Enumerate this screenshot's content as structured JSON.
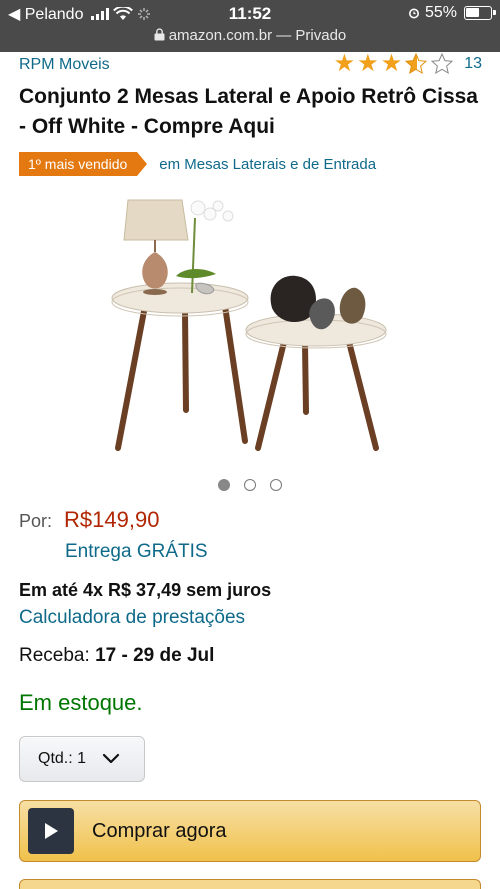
{
  "status_bar": {
    "carrier": "◀ Pelando",
    "time": "11:52",
    "battery": "55%",
    "url": "amazon.com.br — Privado"
  },
  "product": {
    "brand": "RPM Moveis",
    "rating": {
      "stars": 3.5,
      "count": "13"
    },
    "title": "Conjunto 2 Mesas Lateral e Apoio Retrô Cissa - Off White - Compre Aqui",
    "best_seller": {
      "badge": "1º mais vendido",
      "category": "em Mesas Laterais e de Entrada"
    },
    "image_pagination": {
      "total": 3,
      "active": 1
    }
  },
  "pricing": {
    "label": "Por:",
    "price": "R$149,90",
    "shipping": "Entrega GRÁTIS",
    "installments": "Em até 4x R$ 37,49 sem juros",
    "calculator_link": "Calculadora de prestações",
    "delivery_label": "Receba:",
    "delivery_dates": "17 - 29 de Jul",
    "stock": "Em estoque."
  },
  "actions": {
    "qty_label": "Qtd.: 1",
    "buy_now": "Comprar agora"
  },
  "colors": {
    "link": "#0f6a8a",
    "price": "#b12704",
    "in_stock": "#007600",
    "badge": "#e47911",
    "star": "#f0a01a",
    "buy_button": "#f0c14b"
  },
  "icons": [
    "lock-icon",
    "wifi-icon",
    "alarm-icon",
    "battery-icon",
    "star-icon",
    "chevron-down-icon",
    "play-icon"
  ]
}
